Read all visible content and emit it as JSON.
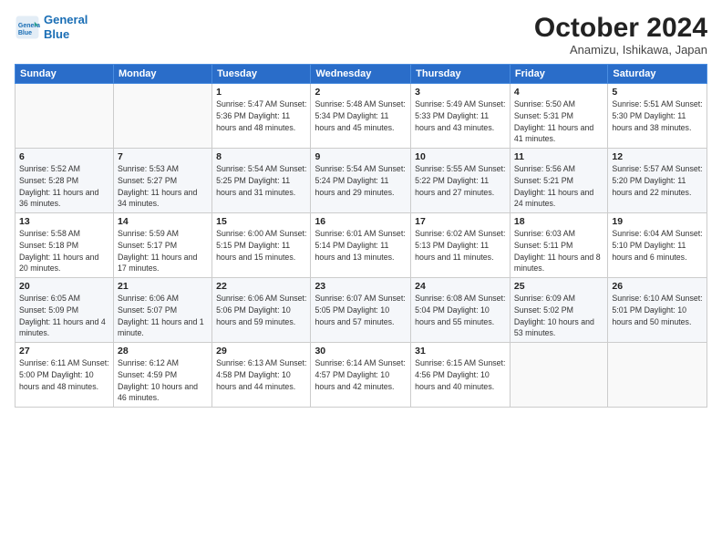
{
  "header": {
    "logo_line1": "General",
    "logo_line2": "Blue",
    "title": "October 2024",
    "subtitle": "Anamizu, Ishikawa, Japan"
  },
  "columns": [
    "Sunday",
    "Monday",
    "Tuesday",
    "Wednesday",
    "Thursday",
    "Friday",
    "Saturday"
  ],
  "weeks": [
    [
      {
        "day": "",
        "detail": ""
      },
      {
        "day": "",
        "detail": ""
      },
      {
        "day": "1",
        "detail": "Sunrise: 5:47 AM\nSunset: 5:36 PM\nDaylight: 11 hours and 48 minutes."
      },
      {
        "day": "2",
        "detail": "Sunrise: 5:48 AM\nSunset: 5:34 PM\nDaylight: 11 hours and 45 minutes."
      },
      {
        "day": "3",
        "detail": "Sunrise: 5:49 AM\nSunset: 5:33 PM\nDaylight: 11 hours and 43 minutes."
      },
      {
        "day": "4",
        "detail": "Sunrise: 5:50 AM\nSunset: 5:31 PM\nDaylight: 11 hours and 41 minutes."
      },
      {
        "day": "5",
        "detail": "Sunrise: 5:51 AM\nSunset: 5:30 PM\nDaylight: 11 hours and 38 minutes."
      }
    ],
    [
      {
        "day": "6",
        "detail": "Sunrise: 5:52 AM\nSunset: 5:28 PM\nDaylight: 11 hours and 36 minutes."
      },
      {
        "day": "7",
        "detail": "Sunrise: 5:53 AM\nSunset: 5:27 PM\nDaylight: 11 hours and 34 minutes."
      },
      {
        "day": "8",
        "detail": "Sunrise: 5:54 AM\nSunset: 5:25 PM\nDaylight: 11 hours and 31 minutes."
      },
      {
        "day": "9",
        "detail": "Sunrise: 5:54 AM\nSunset: 5:24 PM\nDaylight: 11 hours and 29 minutes."
      },
      {
        "day": "10",
        "detail": "Sunrise: 5:55 AM\nSunset: 5:22 PM\nDaylight: 11 hours and 27 minutes."
      },
      {
        "day": "11",
        "detail": "Sunrise: 5:56 AM\nSunset: 5:21 PM\nDaylight: 11 hours and 24 minutes."
      },
      {
        "day": "12",
        "detail": "Sunrise: 5:57 AM\nSunset: 5:20 PM\nDaylight: 11 hours and 22 minutes."
      }
    ],
    [
      {
        "day": "13",
        "detail": "Sunrise: 5:58 AM\nSunset: 5:18 PM\nDaylight: 11 hours and 20 minutes."
      },
      {
        "day": "14",
        "detail": "Sunrise: 5:59 AM\nSunset: 5:17 PM\nDaylight: 11 hours and 17 minutes."
      },
      {
        "day": "15",
        "detail": "Sunrise: 6:00 AM\nSunset: 5:15 PM\nDaylight: 11 hours and 15 minutes."
      },
      {
        "day": "16",
        "detail": "Sunrise: 6:01 AM\nSunset: 5:14 PM\nDaylight: 11 hours and 13 minutes."
      },
      {
        "day": "17",
        "detail": "Sunrise: 6:02 AM\nSunset: 5:13 PM\nDaylight: 11 hours and 11 minutes."
      },
      {
        "day": "18",
        "detail": "Sunrise: 6:03 AM\nSunset: 5:11 PM\nDaylight: 11 hours and 8 minutes."
      },
      {
        "day": "19",
        "detail": "Sunrise: 6:04 AM\nSunset: 5:10 PM\nDaylight: 11 hours and 6 minutes."
      }
    ],
    [
      {
        "day": "20",
        "detail": "Sunrise: 6:05 AM\nSunset: 5:09 PM\nDaylight: 11 hours and 4 minutes."
      },
      {
        "day": "21",
        "detail": "Sunrise: 6:06 AM\nSunset: 5:07 PM\nDaylight: 11 hours and 1 minute."
      },
      {
        "day": "22",
        "detail": "Sunrise: 6:06 AM\nSunset: 5:06 PM\nDaylight: 10 hours and 59 minutes."
      },
      {
        "day": "23",
        "detail": "Sunrise: 6:07 AM\nSunset: 5:05 PM\nDaylight: 10 hours and 57 minutes."
      },
      {
        "day": "24",
        "detail": "Sunrise: 6:08 AM\nSunset: 5:04 PM\nDaylight: 10 hours and 55 minutes."
      },
      {
        "day": "25",
        "detail": "Sunrise: 6:09 AM\nSunset: 5:02 PM\nDaylight: 10 hours and 53 minutes."
      },
      {
        "day": "26",
        "detail": "Sunrise: 6:10 AM\nSunset: 5:01 PM\nDaylight: 10 hours and 50 minutes."
      }
    ],
    [
      {
        "day": "27",
        "detail": "Sunrise: 6:11 AM\nSunset: 5:00 PM\nDaylight: 10 hours and 48 minutes."
      },
      {
        "day": "28",
        "detail": "Sunrise: 6:12 AM\nSunset: 4:59 PM\nDaylight: 10 hours and 46 minutes."
      },
      {
        "day": "29",
        "detail": "Sunrise: 6:13 AM\nSunset: 4:58 PM\nDaylight: 10 hours and 44 minutes."
      },
      {
        "day": "30",
        "detail": "Sunrise: 6:14 AM\nSunset: 4:57 PM\nDaylight: 10 hours and 42 minutes."
      },
      {
        "day": "31",
        "detail": "Sunrise: 6:15 AM\nSunset: 4:56 PM\nDaylight: 10 hours and 40 minutes."
      },
      {
        "day": "",
        "detail": ""
      },
      {
        "day": "",
        "detail": ""
      }
    ]
  ]
}
